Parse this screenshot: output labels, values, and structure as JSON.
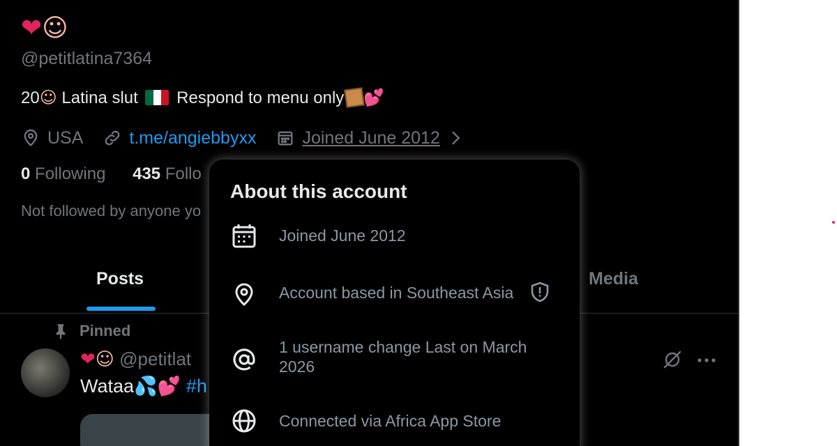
{
  "profile": {
    "display_name_emoji_1": "❤",
    "display_name_emoji_2": "☺",
    "handle": "@petitlatina7364",
    "bio_prefix": "20",
    "bio_emoji": "☺",
    "bio_text_1": " Latina slut ",
    "bio_text_2": " Respond to menu only",
    "bio_emoji_end": "💕",
    "location": "USA",
    "link": "t.me/angiebbyxx",
    "joined": "Joined June 2012",
    "following_count": "0",
    "following_label": "Following",
    "followers_count": "435",
    "followers_label": "Follo",
    "not_followed": "Not followed by anyone yo"
  },
  "tabs": {
    "posts": "Posts",
    "media": "Media"
  },
  "pinned_tweet": {
    "pinned_label": "Pinned",
    "author_emoji_1": "❤",
    "author_emoji_2": "☺",
    "author_handle": "@petitlat",
    "text": "Wataa",
    "text_emoji": "💦💕",
    "hashtag": "#h"
  },
  "about_popover": {
    "title": "About this account",
    "joined": "Joined June 2012",
    "based": "Account based in Southeast Asia",
    "username_change": "1 username change Last on March 2026",
    "connected": "Connected via Africa App Store"
  },
  "colors": {
    "background": "#000000",
    "text_primary": "#e7e9ea",
    "text_secondary": "#71767b",
    "accent": "#1d9bf0",
    "heart": "#e0245e"
  },
  "icons": {
    "location": "location-pin-icon",
    "link": "link-icon",
    "calendar": "calendar-icon",
    "chevron": "chevron-right-icon",
    "pin": "pin-icon",
    "shield": "shield-alert-icon",
    "at": "at-sign-icon",
    "globe": "globe-icon",
    "grok": "grok-icon",
    "more": "more-icon"
  }
}
